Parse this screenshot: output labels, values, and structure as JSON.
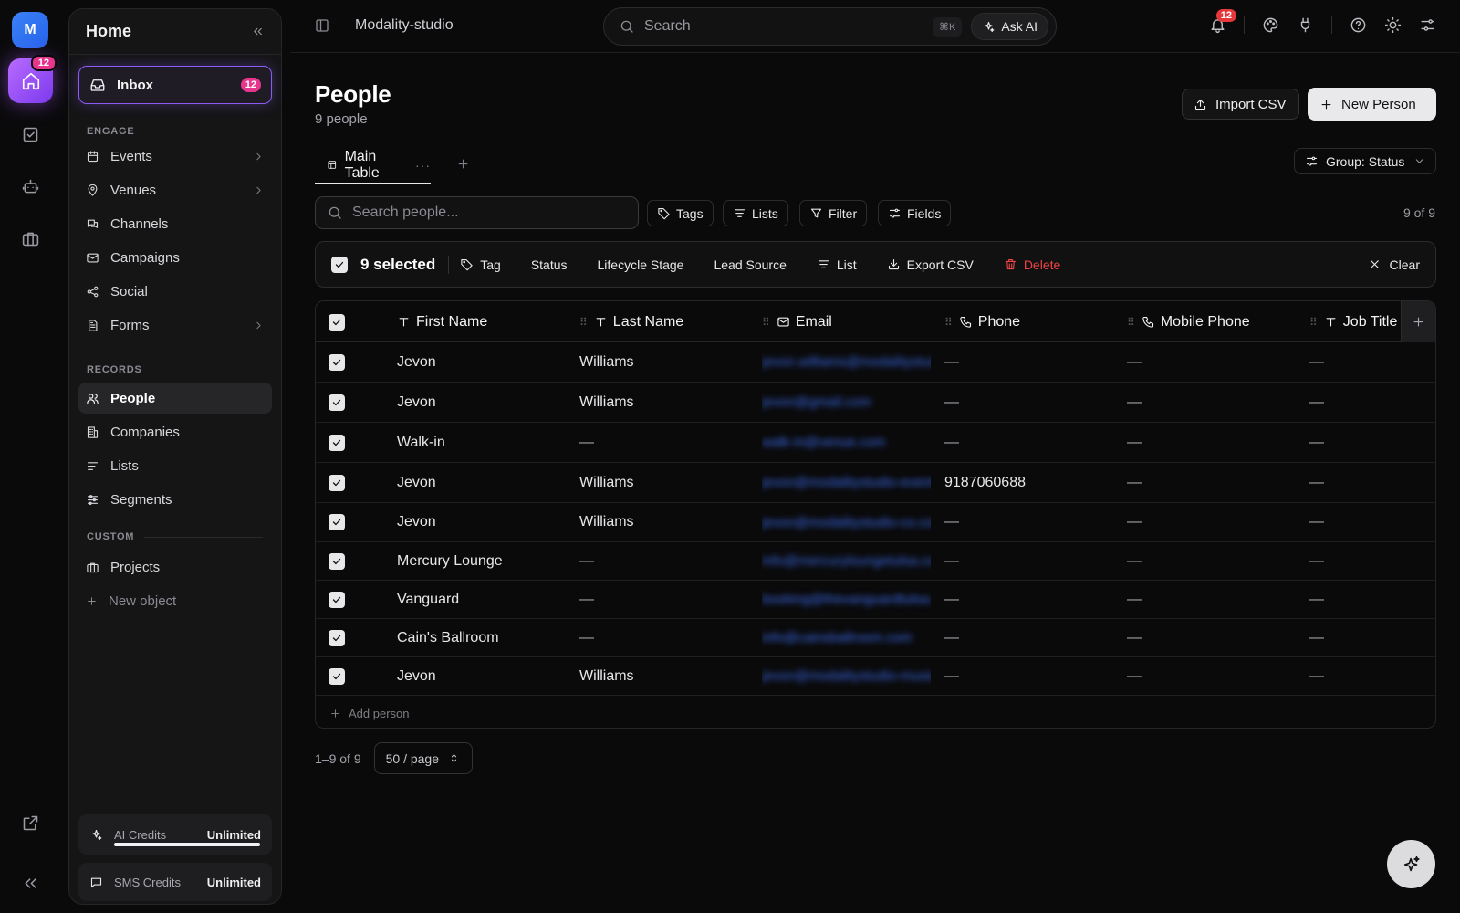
{
  "rail": {
    "avatar_initial": "M",
    "home_badge": "12"
  },
  "sidebar": {
    "title": "Home",
    "inbox": {
      "label": "Inbox",
      "badge": "12"
    },
    "engage_label": "ENGAGE",
    "engage": [
      {
        "label": "Events",
        "icon": "calendar-icon",
        "chevron": true
      },
      {
        "label": "Venues",
        "icon": "map-pin-icon",
        "chevron": true
      },
      {
        "label": "Channels",
        "icon": "messages-icon",
        "chevron": false
      },
      {
        "label": "Campaigns",
        "icon": "mail-icon",
        "chevron": false
      },
      {
        "label": "Social",
        "icon": "share-icon",
        "chevron": false
      },
      {
        "label": "Forms",
        "icon": "form-icon",
        "chevron": true
      }
    ],
    "records_label": "RECORDS",
    "records": [
      {
        "label": "People",
        "icon": "users-icon",
        "active": true
      },
      {
        "label": "Companies",
        "icon": "building-icon",
        "active": false
      },
      {
        "label": "Lists",
        "icon": "list-icon",
        "active": false
      },
      {
        "label": "Segments",
        "icon": "sliders-icon",
        "active": false
      }
    ],
    "custom_label": "CUSTOM",
    "custom": [
      {
        "label": "Projects",
        "icon": "briefcase-icon"
      }
    ],
    "new_object": "New object",
    "credits": [
      {
        "label": "AI Credits",
        "value": "Unlimited",
        "progress": 1.0
      },
      {
        "label": "SMS Credits",
        "value": "Unlimited"
      }
    ]
  },
  "topbar": {
    "workspace": "Modality-studio",
    "search_placeholder": "Search",
    "shortcut": "⌘K",
    "ask_ai": "Ask AI",
    "notifications": "12"
  },
  "page": {
    "title": "People",
    "subtitle": "9 people",
    "import_csv": "Import CSV",
    "new_person": "New Person",
    "tab": "Main Table",
    "group": "Group: Status",
    "search_placeholder": "Search people...",
    "chips": [
      "Tags",
      "Lists",
      "Filter",
      "Fields"
    ],
    "count": "9 of 9"
  },
  "bulk": {
    "selected": "9 selected",
    "actions": [
      "Tag",
      "Status",
      "Lifecycle Stage",
      "Lead Source",
      "List",
      "Export CSV"
    ],
    "delete": "Delete",
    "clear": "Clear"
  },
  "table": {
    "columns": [
      "First Name",
      "Last Name",
      "Email",
      "Phone",
      "Mobile Phone",
      "Job Title"
    ],
    "rows": [
      {
        "first": "Jevon",
        "last": "Williams",
        "email": "jevon.williams@modalitystudio.com",
        "phone": "—",
        "mobile": "—",
        "job": "—"
      },
      {
        "first": "Jevon",
        "last": "Williams",
        "email": "jevon@gmail.com",
        "phone": "—",
        "mobile": "—",
        "job": "—"
      },
      {
        "first": "Walk-in",
        "last": "—",
        "email": "walk-in@venue.com",
        "phone": "—",
        "mobile": "—",
        "job": "—"
      },
      {
        "first": "Jevon",
        "last": "Williams",
        "email": "jevon@modalitystudio-events.com",
        "phone": "9187060688",
        "mobile": "—",
        "job": "—"
      },
      {
        "first": "Jevon",
        "last": "Williams",
        "email": "jevon@modalitystudio-co.com",
        "phone": "—",
        "mobile": "—",
        "job": "—"
      },
      {
        "first": "Mercury Lounge",
        "last": "—",
        "email": "info@mercuryloungetulsa.com",
        "phone": "—",
        "mobile": "—",
        "job": "—"
      },
      {
        "first": "Vanguard",
        "last": "—",
        "email": "booking@thevanguardtulsa.com",
        "phone": "—",
        "mobile": "—",
        "job": "—"
      },
      {
        "first": "Cain's Ballroom",
        "last": "—",
        "email": "info@cainsballroom.com",
        "phone": "—",
        "mobile": "—",
        "job": "—"
      },
      {
        "first": "Jevon",
        "last": "Williams",
        "email": "jevon@modalitystudio-music.com",
        "phone": "—",
        "mobile": "—",
        "job": "—"
      }
    ],
    "add_person": "Add person"
  },
  "pager": {
    "range": "1–9 of 9",
    "per_page": "50 / page"
  }
}
